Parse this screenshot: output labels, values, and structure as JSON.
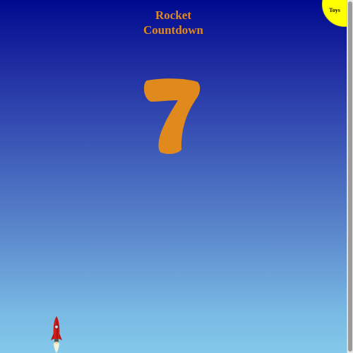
{
  "page": {
    "title_line1": "Rocket",
    "title_line2": "Countdown"
  },
  "countdown": {
    "value": "7",
    "color": "#e08a1e"
  },
  "toys_button": {
    "label": "Toys",
    "color": "#ffff00"
  },
  "background": {
    "top_color": "#000a8f",
    "bottom_color": "#84c9ea"
  },
  "icons": {
    "rocket": "rocket-icon"
  }
}
